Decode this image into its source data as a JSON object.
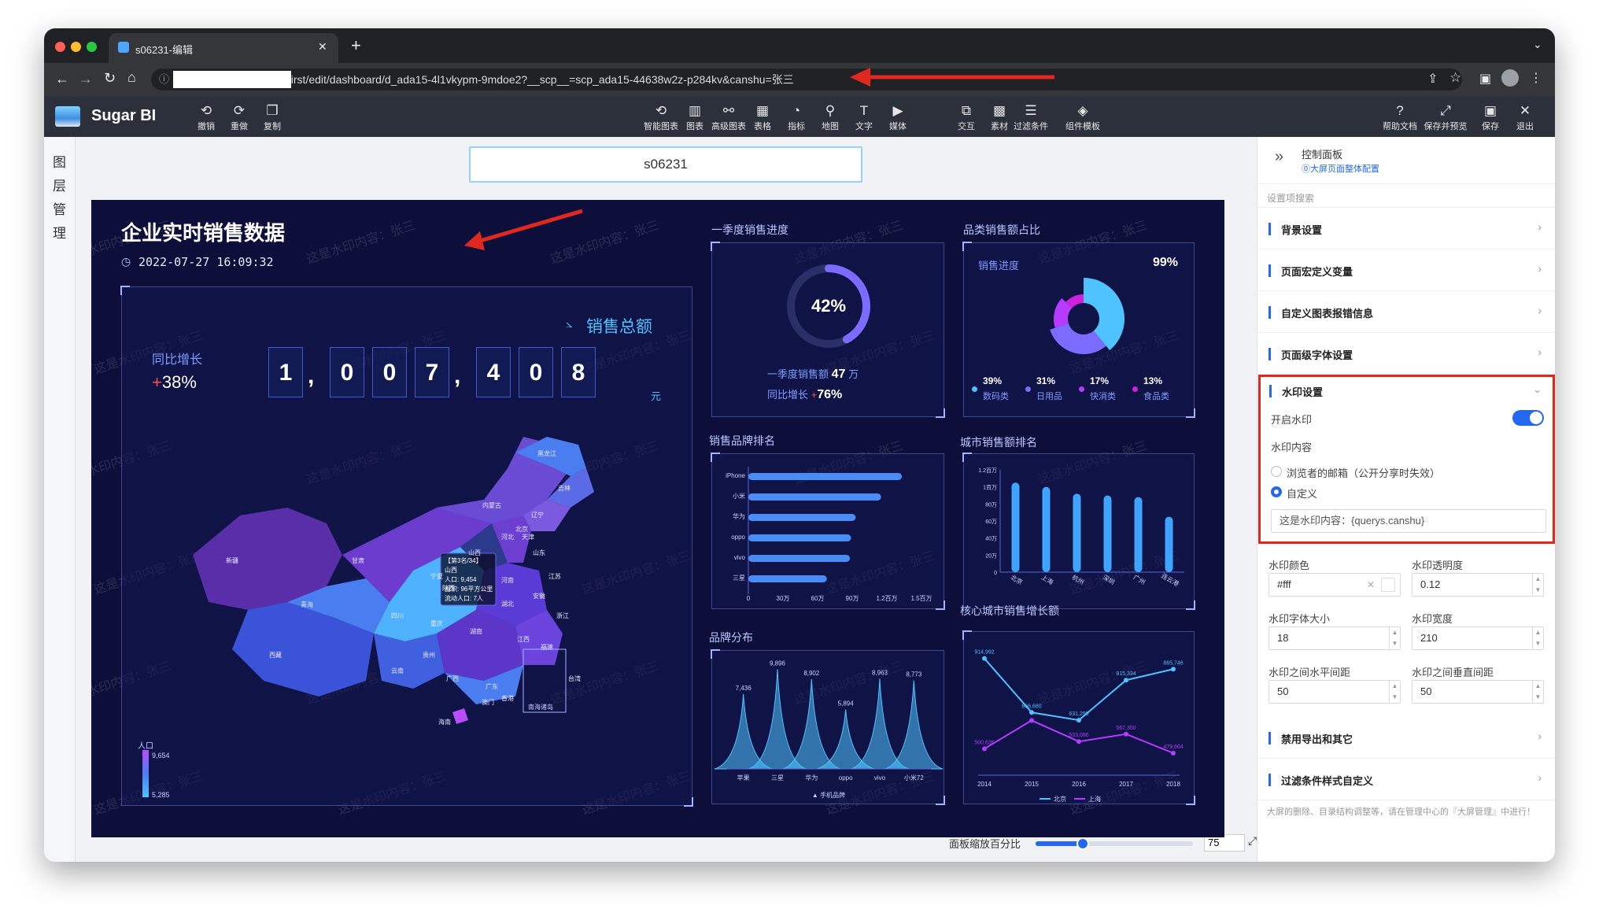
{
  "browser": {
    "tab_title": "s06231-编辑",
    "url": "/first/edit/dashboard/d_ada15-4l1vkypm-9mdoe2?__scp__=scp_ada15-44638w2z-p284kv&canshu=张三"
  },
  "app": {
    "brand": "Sugar BI",
    "left_tools": [
      {
        "label": "撤销",
        "icon": "undo-icon",
        "glyph": "⟲"
      },
      {
        "label": "重做",
        "icon": "redo-icon",
        "glyph": "⟳"
      },
      {
        "label": "复制",
        "icon": "copy-icon",
        "glyph": "❐"
      }
    ],
    "center_tools": [
      {
        "label": "智能图表",
        "icon": "smart-chart-icon",
        "glyph": "⟲"
      },
      {
        "label": "图表",
        "icon": "chart-icon",
        "glyph": "▥"
      },
      {
        "label": "高级图表",
        "icon": "advanced-chart-icon",
        "glyph": "⚯"
      },
      {
        "label": "表格",
        "icon": "table-icon",
        "glyph": "▦"
      },
      {
        "label": "指标",
        "icon": "gauge-icon",
        "glyph": "◔"
      },
      {
        "label": "地图",
        "icon": "map-icon",
        "glyph": "⚲"
      },
      {
        "label": "文字",
        "icon": "text-icon",
        "glyph": "T"
      },
      {
        "label": "媒体",
        "icon": "media-icon",
        "glyph": "▶"
      },
      {
        "label": "交互",
        "icon": "interaction-icon",
        "glyph": "⧉"
      },
      {
        "label": "素材",
        "icon": "material-icon",
        "glyph": "▩"
      },
      {
        "label": "过滤条件",
        "icon": "filter-icon",
        "glyph": "☰"
      },
      {
        "label": "组件模板",
        "icon": "template-icon",
        "glyph": "◈"
      }
    ],
    "right_tools": [
      {
        "label": "帮助文档",
        "icon": "help-icon",
        "glyph": "?"
      },
      {
        "label": "保存并预览",
        "icon": "expand-icon",
        "glyph": "⤢"
      },
      {
        "label": "保存",
        "icon": "save-icon",
        "glyph": "▣"
      },
      {
        "label": "退出",
        "icon": "close-icon",
        "glyph": "✕"
      }
    ]
  },
  "left_rail": {
    "label": "图层管理"
  },
  "page_name": "s06231",
  "zoom": {
    "label": "面板缩放百分比",
    "value": "75",
    "percent": 75
  },
  "watermark_text": "这是水印内容：张三",
  "dashboard": {
    "title": "企业实时销售数据",
    "datetime": "2022-07-27 16:09:32",
    "total": {
      "label": "销售总额",
      "digits": [
        "1",
        "0",
        "0",
        "7",
        "4",
        "0",
        "8"
      ],
      "unit": "元",
      "yoy_label": "同比增长",
      "yoy_value": "+38%"
    },
    "q1": {
      "title": "一季度销售进度",
      "percent_text": "42%",
      "percent": 42,
      "sales_label": "一季度销售额",
      "sales_value": "47",
      "sales_unit": "万",
      "yoy_label": "同比增长",
      "yoy_value": "+76%"
    },
    "category": {
      "title": "品类销售额占比",
      "progress_label": "销售进度",
      "progress_value": "99%",
      "items": [
        {
          "pct": "39%",
          "name": "数码类",
          "color": "#4fc3ff"
        },
        {
          "pct": "31%",
          "name": "日用品",
          "color": "#7b6cff"
        },
        {
          "pct": "17%",
          "name": "快消类",
          "color": "#b43bff"
        },
        {
          "pct": "13%",
          "name": "食品类",
          "color": "#d020e0"
        }
      ]
    },
    "brand_rank": {
      "title": "销售品牌排名",
      "x_ticks": [
        "0",
        "30万",
        "60万",
        "90万",
        "1.2百万",
        "1.5百万"
      ]
    },
    "city_rank": {
      "title": "城市销售额排名",
      "y_ticks": [
        "0",
        "20万",
        "40万",
        "60万",
        "80万",
        "1百万",
        "1.2百万"
      ]
    },
    "brand_dist": {
      "title": "品牌分布",
      "legend": "手机品牌"
    },
    "city_growth": {
      "title": "核心城市销售增长额",
      "legend": [
        "北京",
        "上海"
      ]
    },
    "map": {
      "legend_title": "人口",
      "legend_max": "9,654",
      "legend_min": "5,285",
      "provinces": [
        "黑龙江",
        "吉林",
        "辽宁",
        "内蒙古",
        "新疆",
        "青海",
        "西藏",
        "四川",
        "甘肃",
        "宁夏",
        "陕西",
        "山西",
        "河北",
        "北京",
        "天津",
        "山东",
        "河南",
        "湖北",
        "湖南",
        "江西",
        "安徽",
        "江苏",
        "浙江",
        "福建",
        "广东",
        "广西",
        "云南",
        "贵州",
        "重庆",
        "海南",
        "台湾",
        "香港",
        "澳门"
      ],
      "tooltip": {
        "line1": "【第3名/34】",
        "line2": "山西",
        "line3": "人口: 9,454",
        "line4": "面积: 96平方公里",
        "line5": "流动人口: 7人"
      },
      "inset_label": "南海诸岛"
    }
  },
  "chart_data": [
    {
      "type": "bar",
      "title": "销售品牌排名",
      "orientation": "horizontal",
      "categories": [
        "iPhone",
        "小米",
        "华为",
        "oppo",
        "vivo",
        "三星"
      ],
      "values": [
        1330000,
        1150000,
        930000,
        890000,
        880000,
        680000
      ],
      "xlim": [
        0,
        1500000
      ]
    },
    {
      "type": "bar",
      "title": "城市销售额排名",
      "categories": [
        "北京",
        "上海",
        "杭州",
        "深圳",
        "广州",
        "连云港"
      ],
      "values": [
        1050000,
        1000000,
        920000,
        900000,
        880000,
        650000
      ],
      "ylim": [
        0,
        1200000
      ]
    },
    {
      "type": "area",
      "title": "品牌分布",
      "categories": [
        "苹果",
        "三星",
        "华为",
        "oppo",
        "vivo",
        "小米72"
      ],
      "values": [
        7436,
        9896,
        8902,
        5894,
        8963,
        8773
      ],
      "series": [
        {
          "name": "手机品牌",
          "values": [
            7436,
            9896,
            8902,
            5894,
            8963,
            8773
          ]
        }
      ]
    },
    {
      "type": "line",
      "title": "核心城市销售增长额",
      "x": [
        "2014",
        "2015",
        "2016",
        "2017",
        "2018"
      ],
      "series": [
        {
          "name": "北京",
          "values": [
            914992,
            666680,
            631296,
            815334,
            865746
          ],
          "color": "#4fc3ff"
        },
        {
          "name": "上海",
          "values": [
            500000,
            630000,
            533086,
            567350,
            479664
          ],
          "color": "#b43bff"
        }
      ],
      "data_labels": [
        "914,992",
        "666,680",
        "631,296",
        "815,334",
        "865,746",
        "500,636",
        "533,086",
        "567,350",
        "479,664"
      ]
    },
    {
      "type": "pie",
      "title": "品类销售额占比",
      "categories": [
        "数码类",
        "日用品",
        "快消类",
        "食品类"
      ],
      "values": [
        39,
        31,
        17,
        13
      ]
    }
  ],
  "panel": {
    "header": "控制面板",
    "link": "⓪大屏页面整体配置",
    "search_placeholder": "设置项搜索",
    "sections_top": [
      "背景设置",
      "页面宏定义变量",
      "自定义图表报错信息",
      "页面级字体设置"
    ],
    "watermark": {
      "title": "水印设置",
      "enable_label": "开启水印",
      "enabled": true,
      "content_label": "水印内容",
      "option_email": "浏览者的邮箱（公开分享时失效）",
      "option_custom": "自定义",
      "custom_value": "这是水印内容：{querys.canshu}",
      "color_label": "水印颜色",
      "color_value": "#fff",
      "opacity_label": "水印透明度",
      "opacity_value": "0.12",
      "fontsize_label": "水印字体大小",
      "fontsize_value": "18",
      "width_label": "水印宽度",
      "width_value": "210",
      "hgap_label": "水印之间水平间距",
      "hgap_value": "50",
      "vgap_label": "水印之间垂直间距",
      "vgap_value": "50"
    },
    "sections_bottom": [
      "禁用导出和其它",
      "过滤条件样式自定义"
    ],
    "footer": "大屏的删除、目录结构调整等，请在管理中心的『大屏管理』中进行！"
  },
  "colors": {
    "accent": "#2468f2",
    "highlight_border": "#e0281e",
    "dashboard_bg": "#0d0f3a",
    "arrow": "#e0281e"
  }
}
